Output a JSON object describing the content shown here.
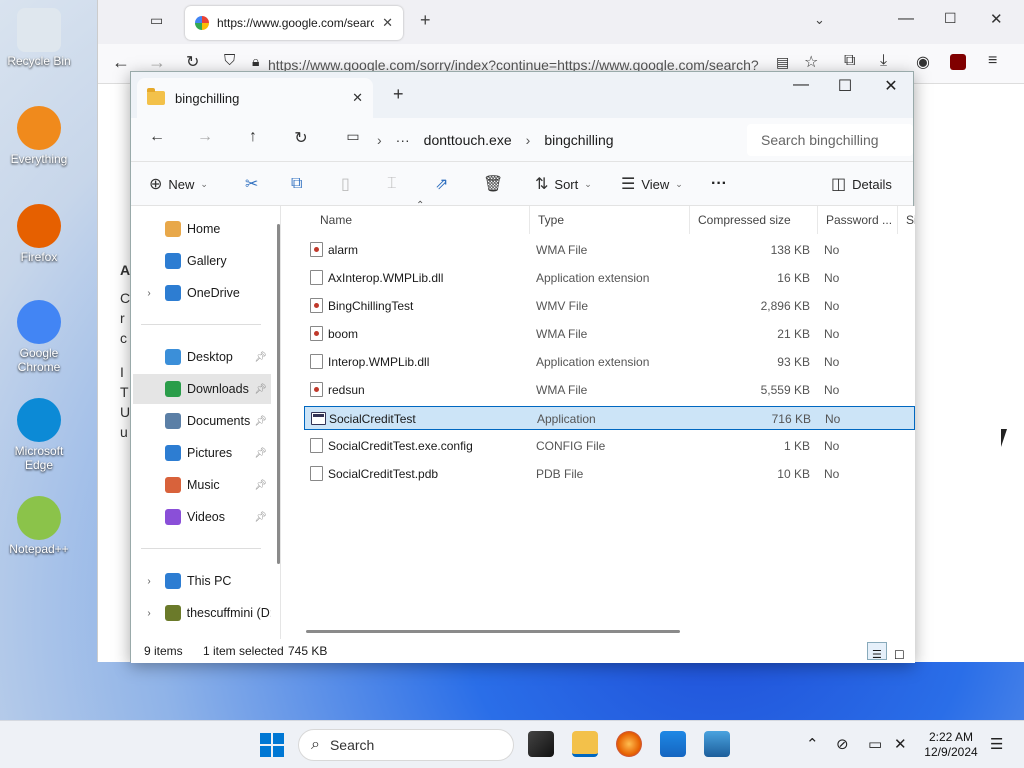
{
  "desktop": {
    "icons": [
      {
        "label": "Recycle Bin",
        "color": "#dfe7ee"
      },
      {
        "label": "Everything",
        "color": "#f08a1c"
      },
      {
        "label": "Firefox",
        "color": "#e66000"
      },
      {
        "label": "Google Chrome",
        "color": "#4285f4"
      },
      {
        "label": "Microsoft Edge",
        "color": "#0c8ad6"
      },
      {
        "label": "Notepad++",
        "color": "#8bc34a"
      }
    ]
  },
  "browser": {
    "tab_title": "https://www.google.com/search",
    "url": "https://www.google.com/sorry/index?continue=https://www.google.com/search?",
    "side_text": [
      "A",
      "C",
      "r",
      "c",
      "I",
      "T",
      "U",
      "u"
    ]
  },
  "explorer": {
    "tab_title": "bingchilling",
    "breadcrumb": [
      "donttouch.exe",
      "bingchilling"
    ],
    "search_placeholder": "Search bingchilling",
    "commands": {
      "new": "New",
      "sort": "Sort",
      "view": "View",
      "more": "···",
      "details": "Details"
    },
    "nav": [
      {
        "label": "Home",
        "color": "#e8a84a"
      },
      {
        "label": "Gallery",
        "color": "#2d7dd2"
      },
      {
        "label": "OneDrive",
        "color": "#2d7dd2"
      },
      {
        "label": "Desktop",
        "color": "#3b8fd9"
      },
      {
        "label": "Downloads",
        "color": "#2a9d4a"
      },
      {
        "label": "Documents",
        "color": "#5b7fa6"
      },
      {
        "label": "Pictures",
        "color": "#2d7dd2"
      },
      {
        "label": "Music",
        "color": "#d8623b"
      },
      {
        "label": "Videos",
        "color": "#8a4fd8"
      },
      {
        "label": "This PC",
        "color": "#2d7dd2"
      },
      {
        "label": "thescuffmini (D:",
        "color": "#6b7a2a"
      }
    ],
    "columns": [
      "Name",
      "Type",
      "Compressed size",
      "Password ...",
      "Si"
    ],
    "files": [
      {
        "name": "alarm",
        "type": "WMA File",
        "size": "138 KB",
        "password": "No",
        "icon": "media"
      },
      {
        "name": "AxInterop.WMPLib.dll",
        "type": "Application extension",
        "size": "16 KB",
        "password": "No",
        "icon": "file"
      },
      {
        "name": "BingChillingTest",
        "type": "WMV File",
        "size": "2,896 KB",
        "password": "No",
        "icon": "media"
      },
      {
        "name": "boom",
        "type": "WMA File",
        "size": "21 KB",
        "password": "No",
        "icon": "media"
      },
      {
        "name": "Interop.WMPLib.dll",
        "type": "Application extension",
        "size": "93 KB",
        "password": "No",
        "icon": "file"
      },
      {
        "name": "redsun",
        "type": "WMA File",
        "size": "5,559 KB",
        "password": "No",
        "icon": "media"
      },
      {
        "name": "SocialCreditTest",
        "type": "Application",
        "size": "716 KB",
        "password": "No",
        "icon": "app"
      },
      {
        "name": "SocialCreditTest.exe.config",
        "type": "CONFIG File",
        "size": "1 KB",
        "password": "No",
        "icon": "file"
      },
      {
        "name": "SocialCreditTest.pdb",
        "type": "PDB File",
        "size": "10 KB",
        "password": "No",
        "icon": "file"
      }
    ],
    "selected_index": 6,
    "status": {
      "count": "9 items",
      "selection": "1 item selected",
      "size": "745 KB"
    }
  },
  "taskbar": {
    "search_label": "Search",
    "time": "2:22 AM",
    "date": "12/9/2024",
    "accent": "#0067c0"
  }
}
